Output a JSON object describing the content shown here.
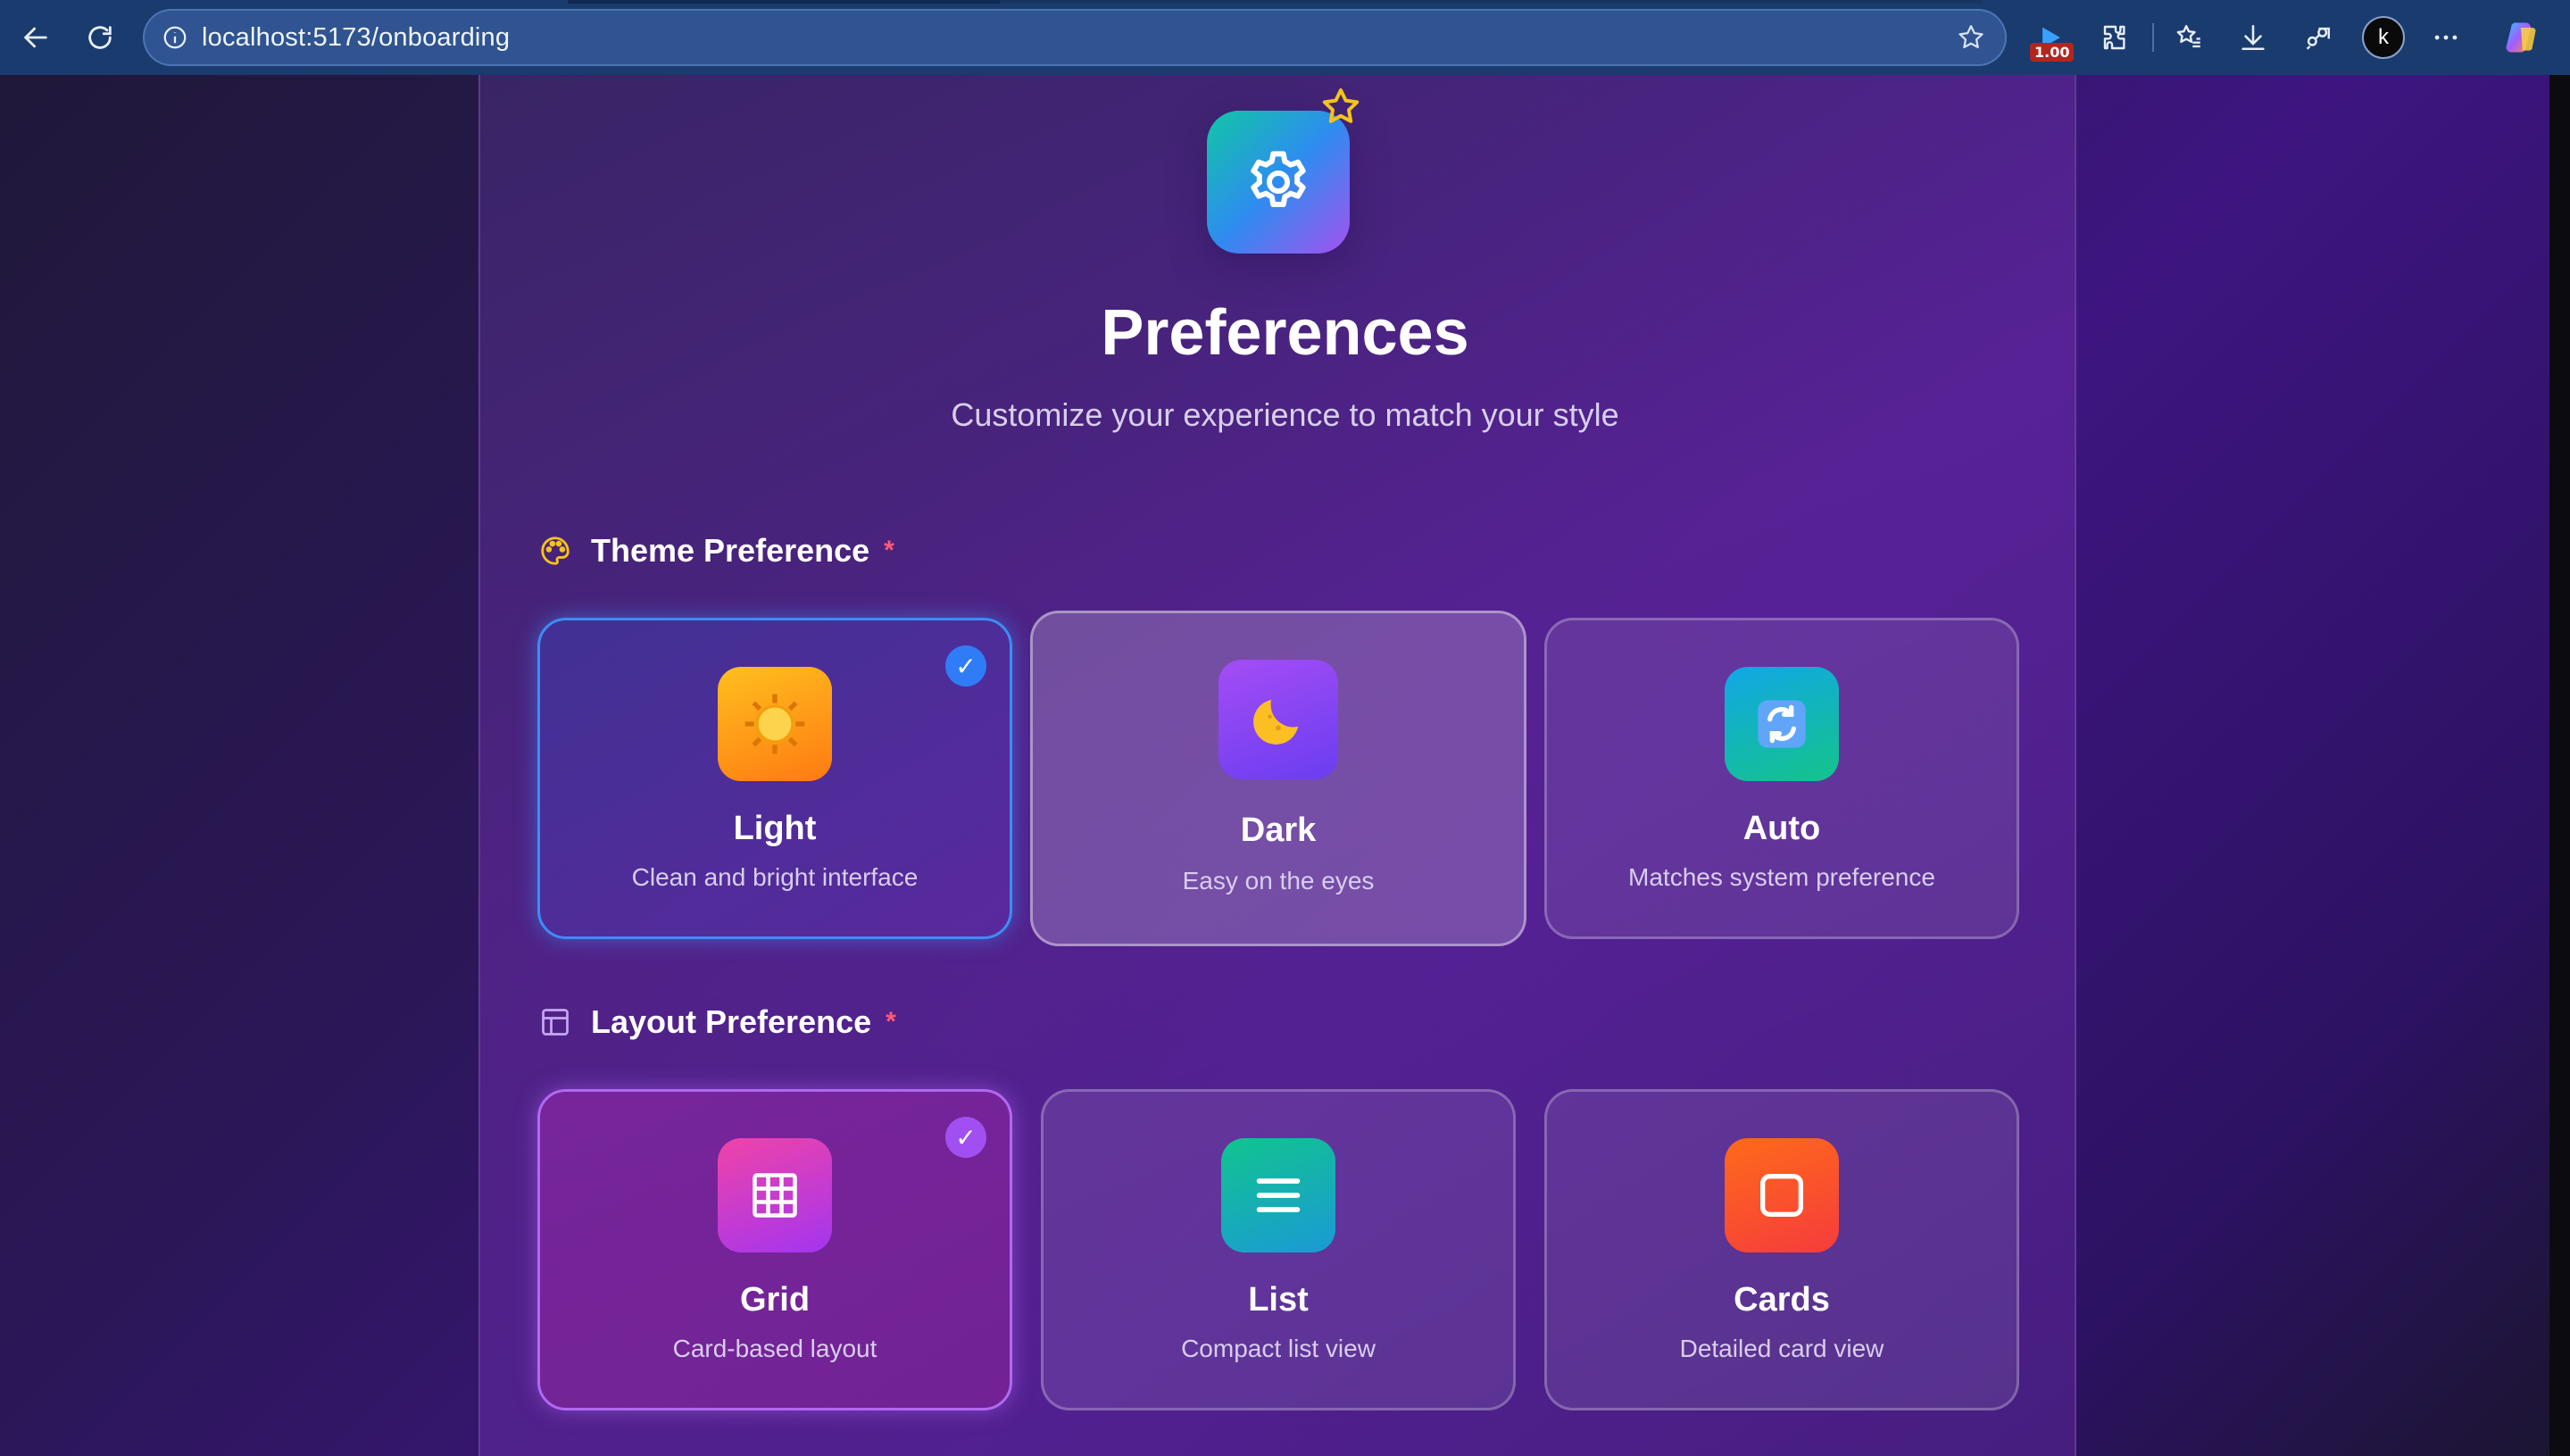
{
  "browser": {
    "url": "localhost:5173/onboarding",
    "extension_badge": "1.00",
    "avatar_letter": "k"
  },
  "header": {
    "title": "Preferences",
    "subtitle": "Customize your experience to match your style"
  },
  "theme_section": {
    "label": "Theme Preference",
    "required_mark": "*",
    "options": [
      {
        "name": "Light",
        "description": "Clean and bright interface",
        "icon": "sun-icon",
        "selected": true
      },
      {
        "name": "Dark",
        "description": "Easy on the eyes",
        "icon": "moon-icon",
        "selected": false
      },
      {
        "name": "Auto",
        "description": "Matches system preference",
        "icon": "sync-icon",
        "selected": false
      }
    ]
  },
  "layout_section": {
    "label": "Layout Preference",
    "required_mark": "*",
    "options": [
      {
        "name": "Grid",
        "description": "Card-based layout",
        "icon": "grid-icon",
        "selected": true
      },
      {
        "name": "List",
        "description": "Compact list view",
        "icon": "list-icon",
        "selected": false
      },
      {
        "name": "Cards",
        "description": "Detailed card view",
        "icon": "card-icon",
        "selected": false
      }
    ]
  },
  "check_glyph": "✓",
  "colors": {
    "theme_selected_border": "#3d8cf5",
    "layout_selected_border": "#b168f2",
    "required_star": "#ff5a7a",
    "star_badge": "#f7c21b"
  }
}
